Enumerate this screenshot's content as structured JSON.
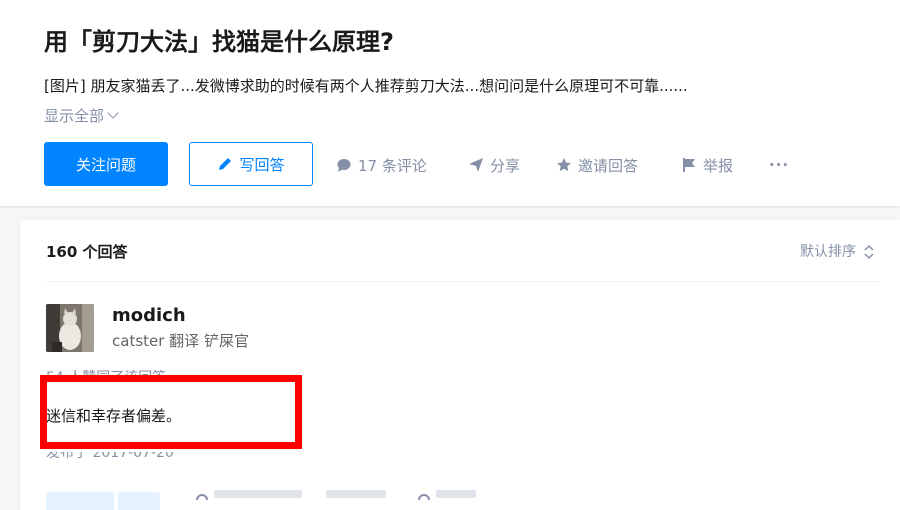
{
  "question": {
    "title": "用「剪刀大法」找猫是什么原理?",
    "excerpt": "[图片] 朋友家猫丢了...发微博求助的时候有两个人推荐剪刀大法...想问问是什么原理可不可靠......",
    "show_all_label": "显示全部"
  },
  "actions": {
    "follow_label": "关注问题",
    "write_label": "写回答",
    "comments_label": "17 条评论",
    "share_label": "分享",
    "invite_label": "邀请回答",
    "report_label": "举报",
    "more_label": "···"
  },
  "answers": {
    "count_label": "160 个回答",
    "sort_label": "默认排序"
  },
  "answer": {
    "author_name": "modich",
    "author_bio": "catster 翻译 铲屎官",
    "vote_summary": "54 人赞同了该回答",
    "content": "迷信和幸存者偏差。",
    "published": "发布于 2017-07-20"
  },
  "colors": {
    "brand_blue": "#0084ff",
    "meta_gray": "#8590a6",
    "highlight_red": "#ff0000"
  },
  "icons": [
    "pencil-icon",
    "comment-bubble-icon",
    "paper-plane-icon",
    "star-icon",
    "flag-icon",
    "sort-updown-icon",
    "chevron-down-icon"
  ]
}
